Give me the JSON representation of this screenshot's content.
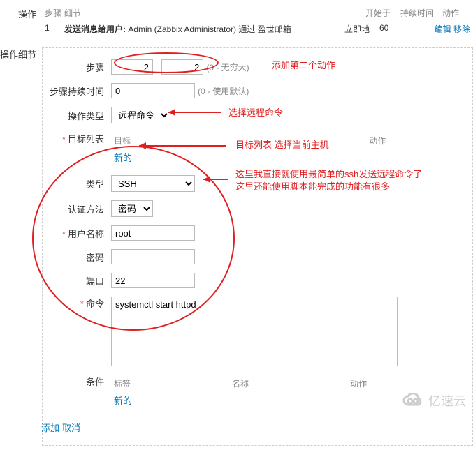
{
  "opsSection": {
    "label": "操作",
    "header": {
      "step": "步骤",
      "detail": "细节",
      "starts": "开始于",
      "duration": "持续时间",
      "action": "动作"
    },
    "row1": {
      "step": "1",
      "detail_bold": "发送消息给用户:",
      "detail_rest": " Admin (Zabbix Administrator) 通过 盈世邮箱",
      "starts": "立即地",
      "duration": "60",
      "edit": "编辑",
      "remove": "移除"
    }
  },
  "detailSection": {
    "label": "操作细节",
    "steps": {
      "label": "步骤",
      "from": "2",
      "to": "2",
      "hint": "(0 - 无穷大)"
    },
    "duration": {
      "label": "步骤持续时间",
      "value": "0",
      "hint": "(0 - 使用默认)"
    },
    "opType": {
      "label": "操作类型",
      "value": "远程命令"
    },
    "targetList": {
      "label": "目标列表",
      "col_target": "目标",
      "col_action": "动作",
      "new": "新的"
    },
    "type": {
      "label": "类型",
      "value": "SSH"
    },
    "auth": {
      "label": "认证方法",
      "value": "密码"
    },
    "username": {
      "label": "用户名称",
      "value": "root"
    },
    "password": {
      "label": "密码",
      "value": ""
    },
    "port": {
      "label": "端口",
      "value": "22"
    },
    "command": {
      "label": "命令",
      "value": "systemctl start httpd"
    },
    "conditions": {
      "label": "条件",
      "col_label": "标签",
      "col_name": "名称",
      "col_action": "动作",
      "new": "新的"
    },
    "actions": {
      "add": "添加",
      "cancel": "取消"
    }
  },
  "annotations": {
    "add_second_action": "添加第二个动作",
    "choose_remote_cmd": "选择远程命令",
    "target_select_host": "目标列表 选择当前主机",
    "ssh_note_line1": "这里我直接就使用最简单的ssh发送远程命令了",
    "ssh_note_line2": "这里还能使用脚本能完成的功能有很多"
  },
  "watermark": "亿速云"
}
